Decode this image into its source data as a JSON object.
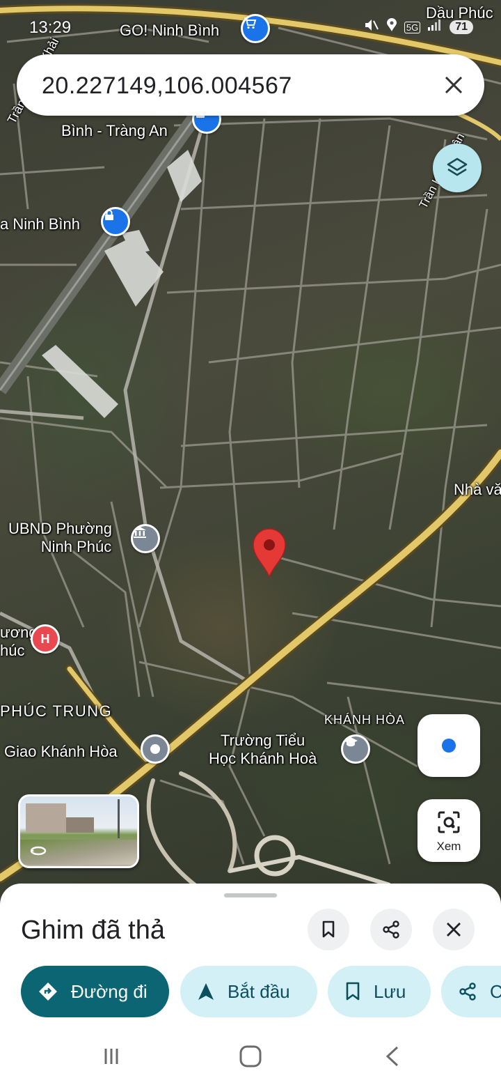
{
  "status": {
    "time": "13:29",
    "battery": "71",
    "network": "5G"
  },
  "search": {
    "query": "20.227149,106.004567"
  },
  "map": {
    "labels": {
      "dau_phuc": "Dầu Phúc",
      "go_ninh_binh": "GO! Ninh Bình",
      "binh_trang_an": "Bình - Tràng An",
      "ninh_binh": "a Ninh Bình",
      "tran_quang_khai": "Trần Quang Khải",
      "tran_khat_chan": "Trần Khát Chân",
      "nha_va": "Nhà vă",
      "ubnd_line1": "UBND Phường",
      "ubnd_line2": "Ninh Phúc",
      "hospital_line1": "ương",
      "hospital_line2": "húc",
      "phuc_trung": "PHÚC TRUNG",
      "giao_khanh_hoa": "Giao Khánh Hòa",
      "khanh_hoa": "KHÁNH HÒA",
      "school_line1": "Trường Tiểu",
      "school_line2": "Học Khánh Hoà"
    },
    "pin_color": "#e53935",
    "road_color": "#e3c86a"
  },
  "controls": {
    "lens_label": "Xem"
  },
  "sheet": {
    "title": "Ghim đã thả",
    "chips": {
      "directions": "Đường đi",
      "start": "Bắt đầu",
      "save": "Lưu",
      "share": "C"
    }
  }
}
